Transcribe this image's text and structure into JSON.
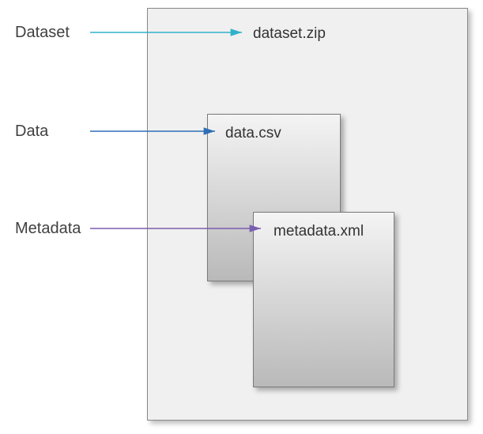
{
  "labels": {
    "dataset": "Dataset",
    "data": "Data",
    "metadata": "Metadata"
  },
  "files": {
    "dataset_zip": "dataset.zip",
    "data_csv": "data.csv",
    "metadata_xml": "metadata.xml"
  },
  "colors": {
    "arrow_dataset": "#2fb2c9",
    "arrow_data": "#2e6fb5",
    "arrow_metadata": "#7a5fb0"
  }
}
